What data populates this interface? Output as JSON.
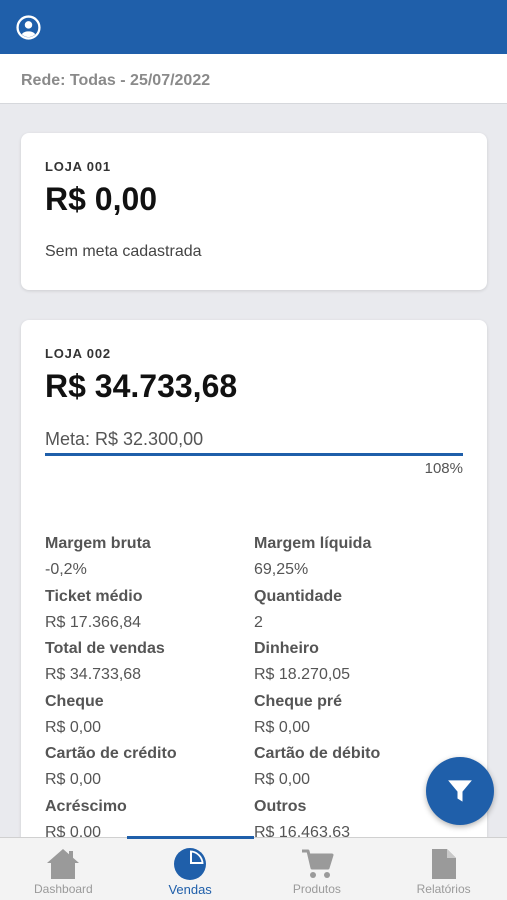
{
  "header": {
    "profile_icon": "user-circle-icon"
  },
  "filter": {
    "label": "Rede: Todas - 25/07/2022"
  },
  "stores": [
    {
      "name": "LOJA 001",
      "amount": "R$ 0,00",
      "goal_text": "Sem meta cadastrada"
    },
    {
      "name": "LOJA 002",
      "amount": "R$ 34.733,68",
      "goal_text": "Meta: R$ 32.300,00",
      "progress": 1.08,
      "progress_label": "108%",
      "metrics": [
        {
          "label": "Margem bruta",
          "value": "-0,2%"
        },
        {
          "label": "Margem líquida",
          "value": "69,25%"
        },
        {
          "label": "Ticket médio",
          "value": "R$ 17.366,84"
        },
        {
          "label": "Quantidade",
          "value": "2"
        },
        {
          "label": "Total de vendas",
          "value": "R$ 34.733,68"
        },
        {
          "label": "Dinheiro",
          "value": "R$ 18.270,05"
        },
        {
          "label": "Cheque",
          "value": "R$ 0,00"
        },
        {
          "label": "Cheque pré",
          "value": "R$ 0,00"
        },
        {
          "label": "Cartão de crédito",
          "value": "R$ 0,00"
        },
        {
          "label": "Cartão de débito",
          "value": "R$ 0,00"
        },
        {
          "label": "Acréscimo",
          "value": "R$ 0,00"
        },
        {
          "label": "Outros",
          "value": "R$ 16.463,63"
        }
      ]
    }
  ],
  "fab": {
    "icon": "filter-icon"
  },
  "nav": {
    "items": [
      {
        "label": "Dashboard",
        "icon": "home-icon",
        "active": false
      },
      {
        "label": "Vendas",
        "icon": "pie-chart-icon",
        "active": true
      },
      {
        "label": "Produtos",
        "icon": "cart-icon",
        "active": false
      },
      {
        "label": "Relatórios",
        "icon": "document-icon",
        "active": false
      }
    ]
  },
  "colors": {
    "primary": "#1f5faa",
    "background": "#e9eaee",
    "inactive": "#9a9a9a"
  }
}
